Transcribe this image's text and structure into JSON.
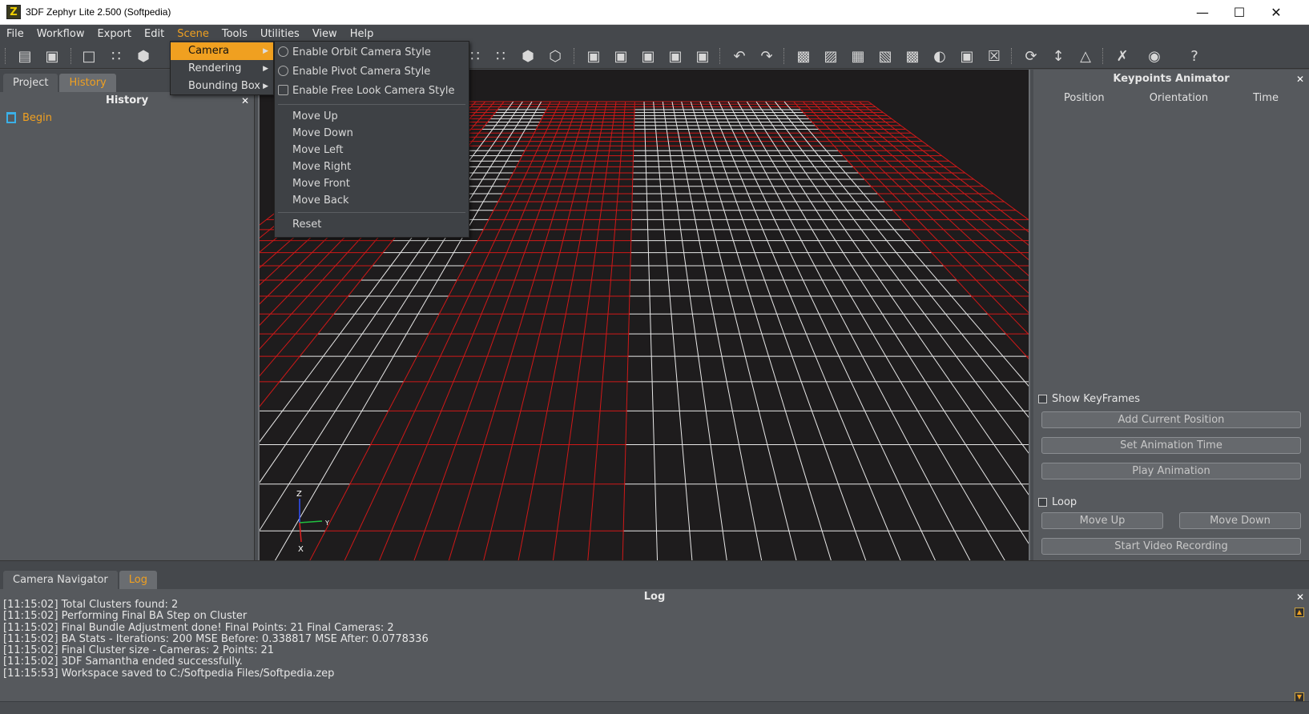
{
  "window": {
    "title": "3DF Zephyr Lite 2.500 (Softpedia)",
    "logo_letter": "Z"
  },
  "menubar": [
    "File",
    "Workflow",
    "Export",
    "Edit",
    "Scene",
    "Tools",
    "Utilities",
    "View",
    "Help"
  ],
  "scene_menu": {
    "items": [
      "Camera",
      "Rendering",
      "Bounding Box"
    ],
    "active": "Camera"
  },
  "camera_submenu": {
    "styles": [
      "Enable Orbit Camera Style",
      "Enable Pivot Camera Style",
      "Enable Free Look Camera Style"
    ],
    "moves": [
      "Move Up",
      "Move Down",
      "Move Left",
      "Move Right",
      "Move Front",
      "Move Back"
    ],
    "reset": "Reset"
  },
  "left_panel": {
    "tabs": [
      "Project",
      "History"
    ],
    "active_tab": "History",
    "header": "History",
    "items": [
      "Begin"
    ]
  },
  "right_panel": {
    "header": "Keypoints Animator",
    "columns": [
      "Position",
      "Orientation",
      "Time"
    ],
    "show_keyframes": "Show KeyFrames",
    "add_current_position": "Add Current Position",
    "set_animation_time": "Set Animation Time",
    "play_animation": "Play Animation",
    "loop": "Loop",
    "move_up": "Move Up",
    "move_down": "Move Down",
    "start_video_recording": "Start Video Recording"
  },
  "bottom_panel": {
    "tabs": [
      "Camera Navigator",
      "Log"
    ],
    "active_tab": "Log",
    "header": "Log",
    "lines": [
      "[11:15:02] Total Clusters found: 2",
      "[11:15:02] Performing Final BA Step on Cluster",
      "[11:15:02] Final Bundle Adjustment done! Final Points: 21 Final Cameras: 2",
      "[11:15:02] BA Stats - Iterations: 200 MSE Before: 0.338817 MSE After: 0.0778336",
      "[11:15:02] Final Cluster size - Cameras: 2 Points: 21",
      "[11:15:02] 3DF Samantha ended successfully.",
      "[11:15:53] Workspace saved to C:/Softpedia Files/Softpedia.zep"
    ]
  },
  "axes": {
    "z": "Z",
    "y": "Y",
    "x": "X"
  },
  "colors": {
    "accent": "#f0a020",
    "grid_red": "#d01818",
    "grid_white": "#e8e8e8"
  }
}
